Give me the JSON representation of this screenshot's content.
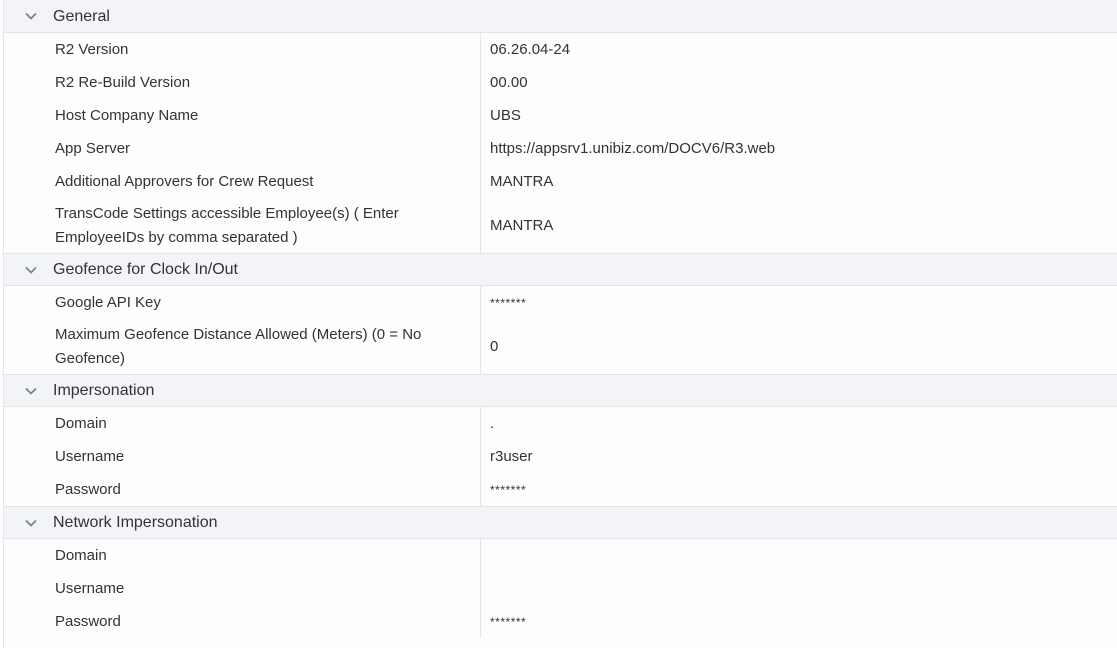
{
  "sections": [
    {
      "title": "General",
      "rows": [
        {
          "label": "R2 Version",
          "value": "06.26.04-24"
        },
        {
          "label": "R2 Re-Build Version",
          "value": "00.00"
        },
        {
          "label": "Host Company Name",
          "value": "UBS"
        },
        {
          "label": "App Server",
          "value": "https://appsrv1.unibiz.com/DOCV6/R3.web"
        },
        {
          "label": "Additional Approvers for Crew Request",
          "value": "MANTRA"
        },
        {
          "label": "TransCode Settings accessible Employee(s) ( Enter EmployeeIDs by comma separated )",
          "value": "MANTRA"
        }
      ]
    },
    {
      "title": "Geofence for Clock In/Out",
      "rows": [
        {
          "label": "Google API Key",
          "value": "*******"
        },
        {
          "label": "Maximum Geofence Distance Allowed (Meters) (0 = No Geofence)",
          "value": "0"
        }
      ]
    },
    {
      "title": "Impersonation",
      "rows": [
        {
          "label": "Domain",
          "value": "."
        },
        {
          "label": "Username",
          "value": "r3user"
        },
        {
          "label": "Password",
          "value": "*******"
        }
      ]
    },
    {
      "title": "Network Impersonation",
      "rows": [
        {
          "label": "Domain",
          "value": ""
        },
        {
          "label": "Username",
          "value": ""
        },
        {
          "label": "Password",
          "value": "*******"
        }
      ]
    }
  ],
  "icons": {
    "section_toggle": "chevron-down-icon"
  },
  "colors": {
    "header_bg": "#f3f4f7",
    "border": "#e3e5ea",
    "text": "#333333"
  }
}
